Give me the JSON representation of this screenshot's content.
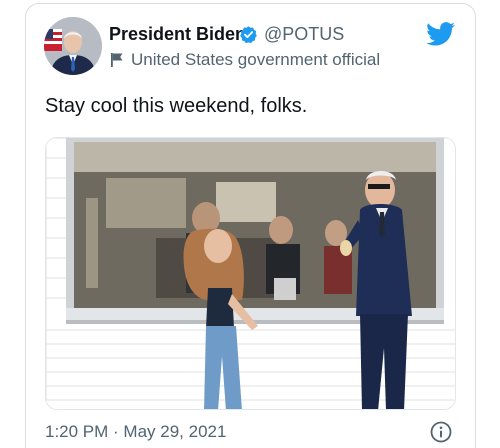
{
  "author": {
    "display_name": "President Biden",
    "handle": "@POTUS",
    "label": "United States government official",
    "avatar_icon": "avatar-photo",
    "verified_icon": "verified-badge-icon",
    "label_icon": "flag-icon"
  },
  "tweet": {
    "text": "Stay cool this weekend, folks.",
    "timestamp": "1:20 PM · May 29, 2021"
  },
  "icons": {
    "brand": "twitter-bird-icon",
    "info": "info-icon"
  },
  "colors": {
    "brand_blue": "#1d9bf0",
    "text_primary": "#0f1419",
    "text_secondary": "#536471"
  }
}
